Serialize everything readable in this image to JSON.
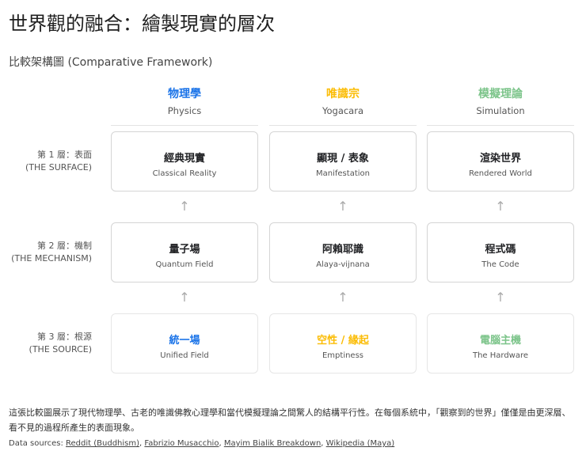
{
  "title": "世界觀的融合：繪製現實的層次",
  "subtitle": "比較架構圖 (Comparative Framework)",
  "colors": {
    "physics": "#1a73e8",
    "yogacara": "#fbbc04",
    "simulation": "#7cc48a"
  },
  "columns": [
    {
      "zh": "物理學",
      "en": "Physics"
    },
    {
      "zh": "唯識宗",
      "en": "Yogacara"
    },
    {
      "zh": "模擬理論",
      "en": "Simulation"
    }
  ],
  "rows": [
    {
      "label_zh": "第 1 層：表面",
      "label_en": "(THE SURFACE)",
      "cells": [
        {
          "zh": "經典現實",
          "en": "Classical Reality"
        },
        {
          "zh": "顯現 / 表象",
          "en": "Manifestation"
        },
        {
          "zh": "渲染世界",
          "en": "Rendered World"
        }
      ]
    },
    {
      "label_zh": "第 2 層：機制",
      "label_en": "(THE MECHANISM)",
      "cells": [
        {
          "zh": "量子場",
          "en": "Quantum Field"
        },
        {
          "zh": "阿賴耶識",
          "en": "Alaya-vijnana"
        },
        {
          "zh": "程式碼",
          "en": "The Code"
        }
      ]
    },
    {
      "label_zh": "第 3 層：根源",
      "label_en": "(THE SOURCE)",
      "cells": [
        {
          "zh": "統一場",
          "en": "Unified Field"
        },
        {
          "zh": "空性 / 緣起",
          "en": "Emptiness"
        },
        {
          "zh": "電腦主機",
          "en": "The Hardware"
        }
      ]
    }
  ],
  "description": "這張比較圖展示了現代物理學、古老的唯識佛教心理學和當代模擬理論之間驚人的結構平行性。在每個系統中，「觀察到的世界」僅僅是由更深層、看不見的過程所產生的表面現象。",
  "sources": {
    "label": "Data sources:",
    "links": [
      "Reddit (Buddhism)",
      "Fabrizio Musacchio",
      "Mayim Bialik Breakdown",
      "Wikipedia (Maya)"
    ]
  }
}
